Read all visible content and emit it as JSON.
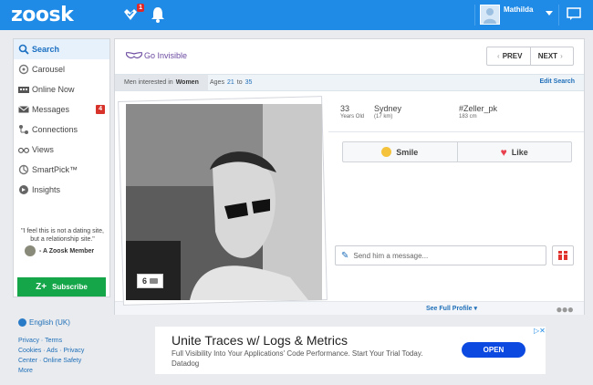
{
  "topbar": {
    "logo": "zoosk",
    "notification_badge": "1",
    "user_name": "Mathilda"
  },
  "sidebar": {
    "items": [
      {
        "label": "Search",
        "icon": "search-icon"
      },
      {
        "label": "Carousel",
        "icon": "carousel-icon"
      },
      {
        "label": "Online Now",
        "icon": "online-icon"
      },
      {
        "label": "Messages",
        "icon": "envelope-icon",
        "badge": "4"
      },
      {
        "label": "Connections",
        "icon": "connections-icon"
      },
      {
        "label": "Views",
        "icon": "glasses-icon"
      },
      {
        "label": "SmartPick™",
        "icon": "smartpick-icon"
      },
      {
        "label": "Insights",
        "icon": "insights-icon"
      }
    ],
    "quote": "\"I feel this is not a dating site, but a relationship site.\"",
    "member": "- A Zoosk Member",
    "subscribe_label": "Subscribe"
  },
  "footer": {
    "language": "English (UK)",
    "links": [
      "Privacy",
      "Terms",
      "Cookies",
      "Ads",
      "Privacy Center",
      "Online Safety",
      "More"
    ]
  },
  "main": {
    "go_invisible": "Go Invisible",
    "prev_label": "PREV",
    "next_label": "NEXT",
    "filter": {
      "prefix": "Men interested in",
      "gender": "Women",
      "ages_label": "Ages",
      "age_min": "21",
      "age_to": "to",
      "age_max": "35",
      "edit": "Edit Search"
    },
    "profile": {
      "age": "33",
      "age_label": "Years Old",
      "city": "Sydney",
      "distance": "(17 km)",
      "username": "#Zeller_pk",
      "height": "183 cm",
      "photo_count": "6"
    },
    "smile_label": "Smile",
    "like_label": "Like",
    "message_placeholder": "Send him a message...",
    "see_full_profile": "See Full Profile"
  },
  "ad": {
    "title": "Unite Traces w/ Logs & Metrics",
    "description": "Full Visibility Into Your Applications' Code Performance. Start Your Trial Today.",
    "source": "Datadog",
    "cta": "OPEN"
  }
}
